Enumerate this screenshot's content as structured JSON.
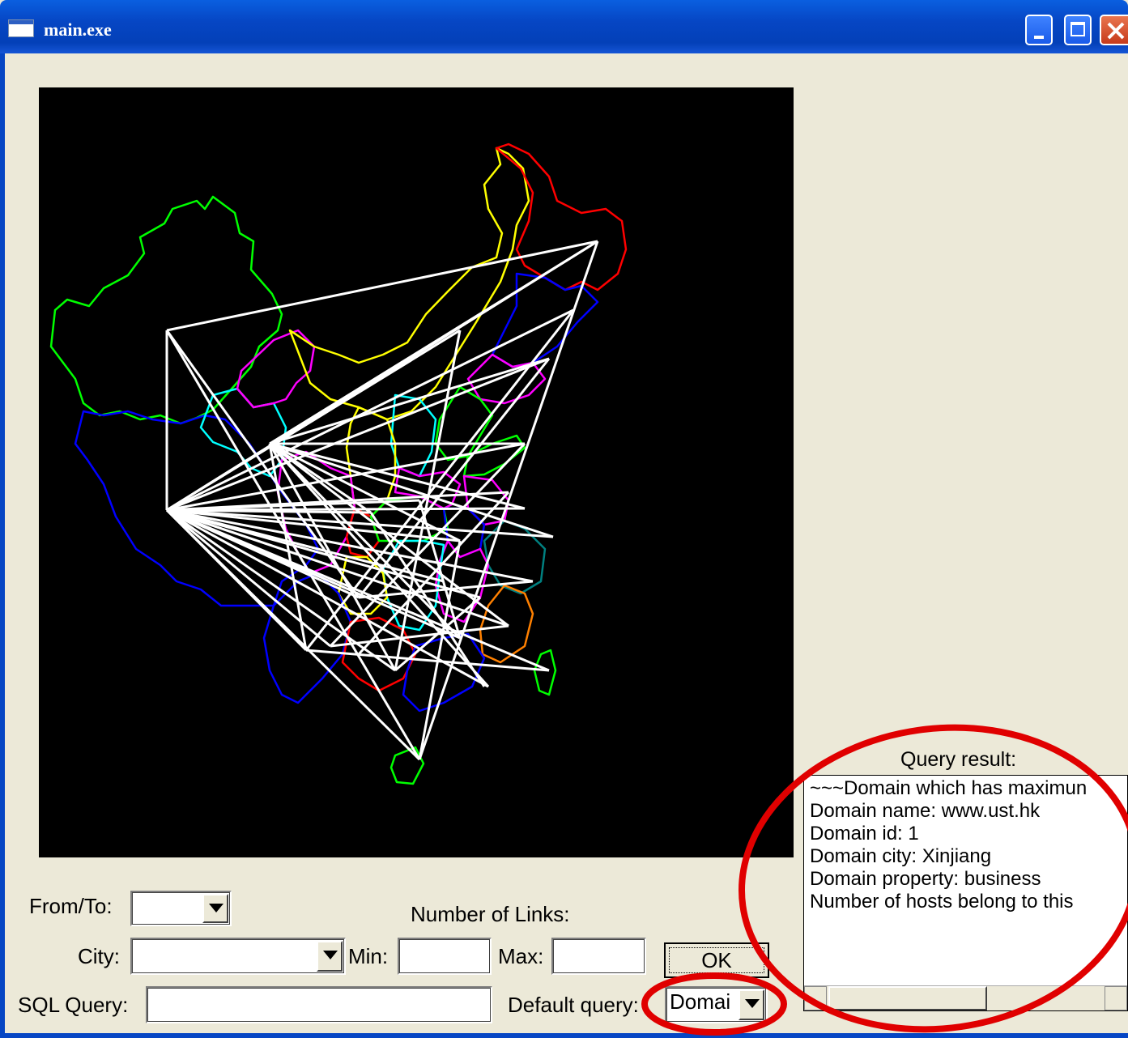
{
  "window": {
    "title": "main.exe"
  },
  "controls": {
    "from_to_label": "From/To:",
    "from_to_value": "",
    "number_of_links_label": "Number of Links:",
    "city_label": "City:",
    "city_value": "",
    "min_label": "Min:",
    "min_value": "",
    "max_label": "Max:",
    "max_value": "",
    "ok_label": "OK",
    "sql_query_label": "SQL Query:",
    "sql_query_value": "",
    "default_query_label": "Default query:",
    "default_query_value": "Domai"
  },
  "query_result": {
    "label": "Query result:",
    "lines": [
      "~~~Domain which has maximun",
      "Domain name: www.ust.hk",
      "Domain id: 1",
      "Domain city: Xinjiang",
      "Domain property: business",
      "Number of hosts belong to this"
    ]
  },
  "annotation_color": "#e00000",
  "map_colors": [
    "#00ff00",
    "#0000ff",
    "#ffff00",
    "#ff0000",
    "#ff00ff",
    "#00ffff",
    "#ff8000",
    "#008080"
  ],
  "link_color": "#ffffff"
}
